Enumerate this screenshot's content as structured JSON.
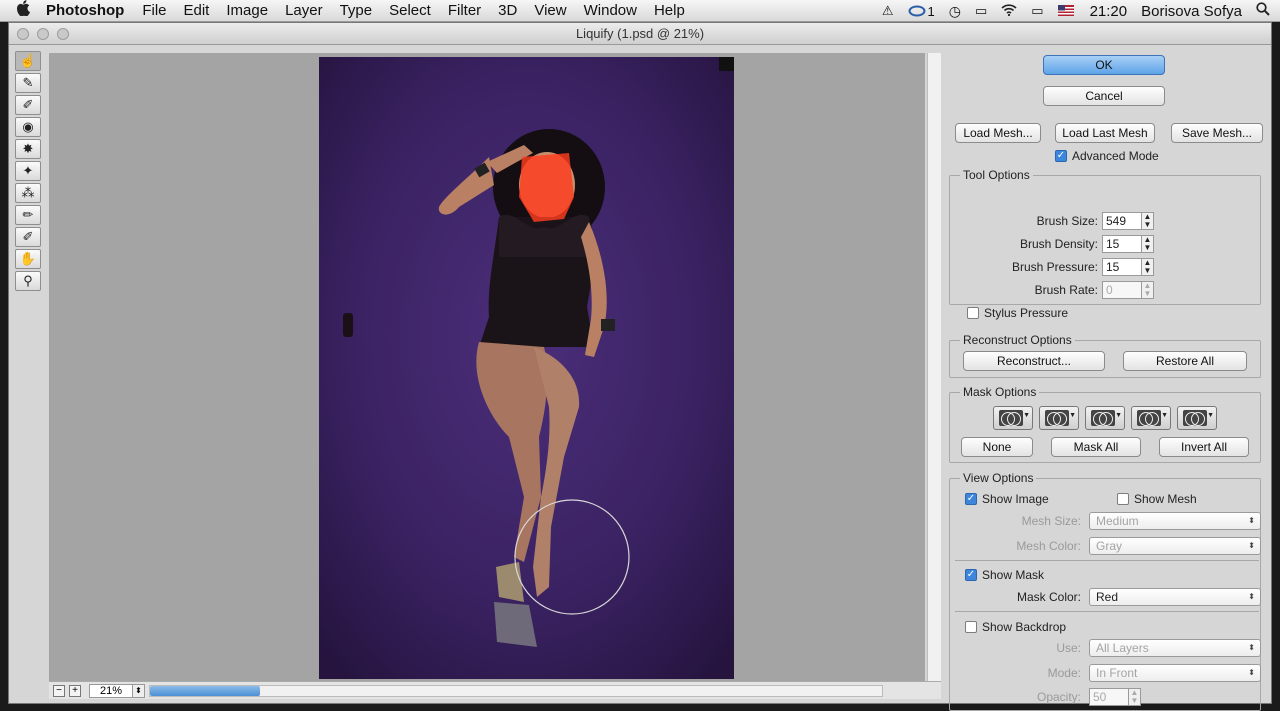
{
  "menubar": {
    "apple": "",
    "app": "Photoshop",
    "items": [
      "File",
      "Edit",
      "Image",
      "Layer",
      "Type",
      "Select",
      "Filter",
      "3D",
      "View",
      "Window",
      "Help"
    ],
    "cc_badge": "1",
    "time": "21:20",
    "user": "Borisova Sofya"
  },
  "window": {
    "title": "Liquify (1.psd @ 21%)"
  },
  "tools": [
    {
      "name": "forward-warp-tool",
      "glyph": "☝"
    },
    {
      "name": "reconstruct-tool",
      "glyph": "✎"
    },
    {
      "name": "smooth-tool",
      "glyph": "✐"
    },
    {
      "name": "twirl-clockwise-tool",
      "glyph": "◉"
    },
    {
      "name": "pucker-tool",
      "glyph": "✸"
    },
    {
      "name": "bloat-tool",
      "glyph": "✦"
    },
    {
      "name": "push-left-tool",
      "glyph": "⁂"
    },
    {
      "name": "freeze-mask-tool",
      "glyph": "✏"
    },
    {
      "name": "thaw-mask-tool",
      "glyph": "✐"
    },
    {
      "name": "hand-tool",
      "glyph": "✋"
    },
    {
      "name": "zoom-tool",
      "glyph": "⚲"
    }
  ],
  "status": {
    "zoom": "21%",
    "scroll_fraction": 0.15
  },
  "panel": {
    "ok": "OK",
    "cancel": "Cancel",
    "load_mesh": "Load Mesh...",
    "load_last_mesh": "Load Last Mesh",
    "save_mesh": "Save Mesh...",
    "advanced_mode": "Advanced Mode",
    "tool_options": {
      "legend": "Tool Options",
      "brush_size_label": "Brush Size:",
      "brush_size": "549",
      "brush_density_label": "Brush Density:",
      "brush_density": "15",
      "brush_pressure_label": "Brush Pressure:",
      "brush_pressure": "15",
      "brush_rate_label": "Brush Rate:",
      "brush_rate": "0",
      "stylus_pressure": "Stylus Pressure"
    },
    "reconstruct_options": {
      "legend": "Reconstruct Options",
      "reconstruct": "Reconstruct...",
      "restore_all": "Restore All"
    },
    "mask_options": {
      "legend": "Mask Options",
      "none": "None",
      "mask_all": "Mask All",
      "invert_all": "Invert All"
    },
    "view_options": {
      "legend": "View Options",
      "show_image": "Show Image",
      "show_mesh": "Show Mesh",
      "mesh_size_label": "Mesh Size:",
      "mesh_size": "Medium",
      "mesh_color_label": "Mesh Color:",
      "mesh_color": "Gray",
      "show_mask": "Show Mask",
      "mask_color_label": "Mask Color:",
      "mask_color": "Red",
      "show_backdrop": "Show Backdrop",
      "use_label": "Use:",
      "use": "All Layers",
      "mode_label": "Mode:",
      "mode": "In Front",
      "opacity_label": "Opacity:",
      "opacity": "50"
    }
  },
  "colors": {
    "mask": "#ff3c1e",
    "backdrop": "#3b2263",
    "accent": "#5ea3e8"
  }
}
